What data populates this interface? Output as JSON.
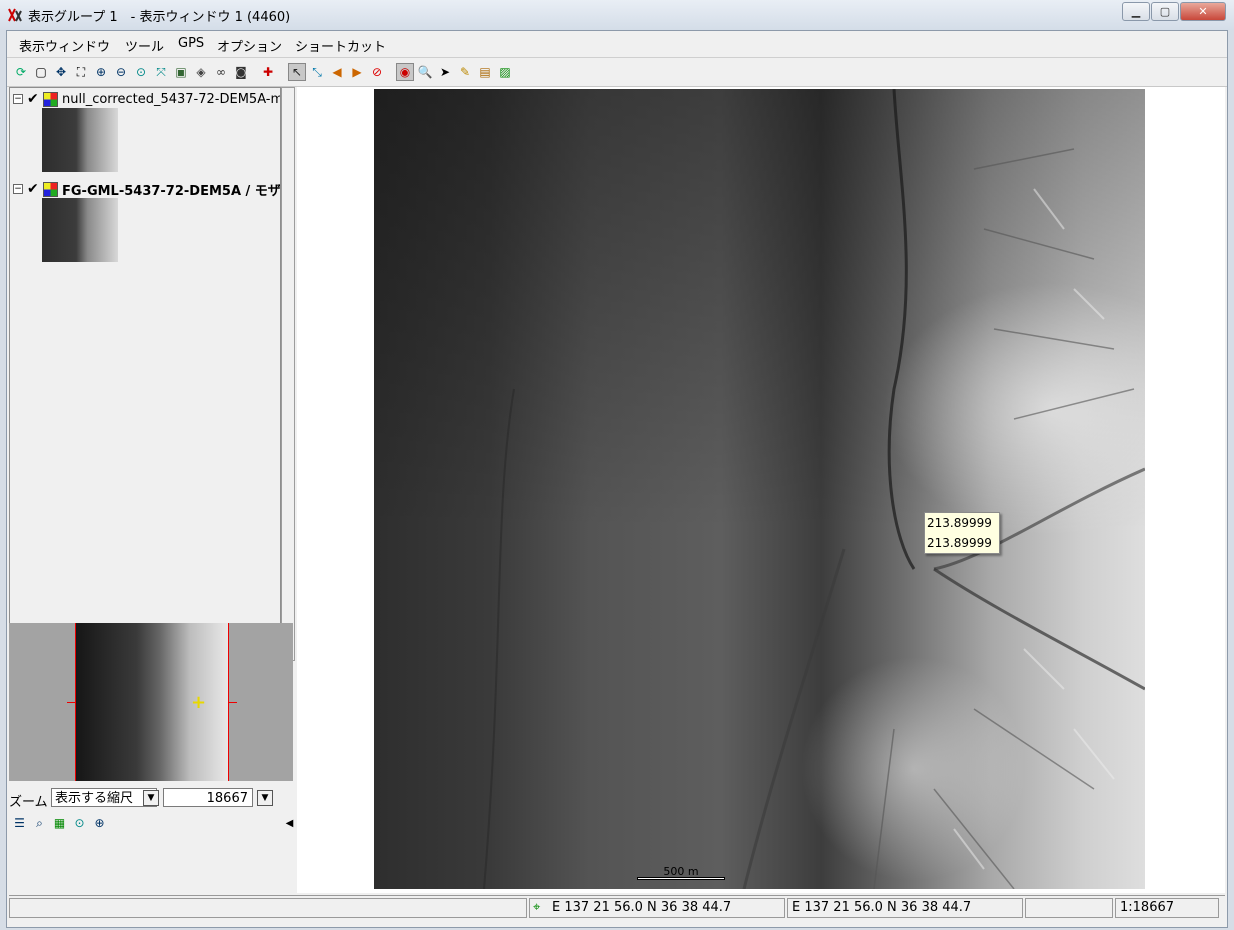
{
  "window": {
    "title": "表示グループ 1　- 表示ウィンドウ 1 (4460)",
    "minimize_label": "▁",
    "maximize_label": "▢",
    "close_label": "✕"
  },
  "menubar": {
    "items": [
      "表示ウィンドウ",
      "ツール",
      "GPS",
      "オプション",
      "ショートカット"
    ]
  },
  "toolbar": {
    "icons": [
      "redraw-icon",
      "full-view-icon",
      "pan-icon",
      "zoom-box-icon",
      "zoom-in-icon",
      "zoom-out-icon",
      "zoom-actual-icon",
      "zoom-layer-icon",
      "fit-icon",
      "view-3d-icon",
      "binoculars-icon",
      "camera-icon",
      "add-layer-icon",
      "select-tool-icon",
      "measure-icon",
      "prev-view-icon",
      "next-view-icon",
      "stop-icon",
      "gps-icon",
      "magnify-icon",
      "pointer-icon",
      "sketch-icon",
      "legend-icon",
      "image-icon"
    ]
  },
  "layers": [
    {
      "name": "null_corrected_5437-72-DEM5A-m",
      "checked": true,
      "bold": false
    },
    {
      "name": "FG-GML-5437-72-DEM5A / モザ",
      "checked": true,
      "bold": true
    }
  ],
  "zoom": {
    "label": "ズーム",
    "mode": "表示する縮尺",
    "value": "18667"
  },
  "map": {
    "tooltip_line1": "213.89999",
    "tooltip_line2": "213.89999",
    "scale_label": "500 m"
  },
  "status": {
    "cell1": "",
    "coord1": "E 137 21 56.0  N 36 38 44.7",
    "coord2": "E 137 21 56.0  N 36 38 44.7",
    "cell4": "",
    "scale": "1:18667"
  }
}
